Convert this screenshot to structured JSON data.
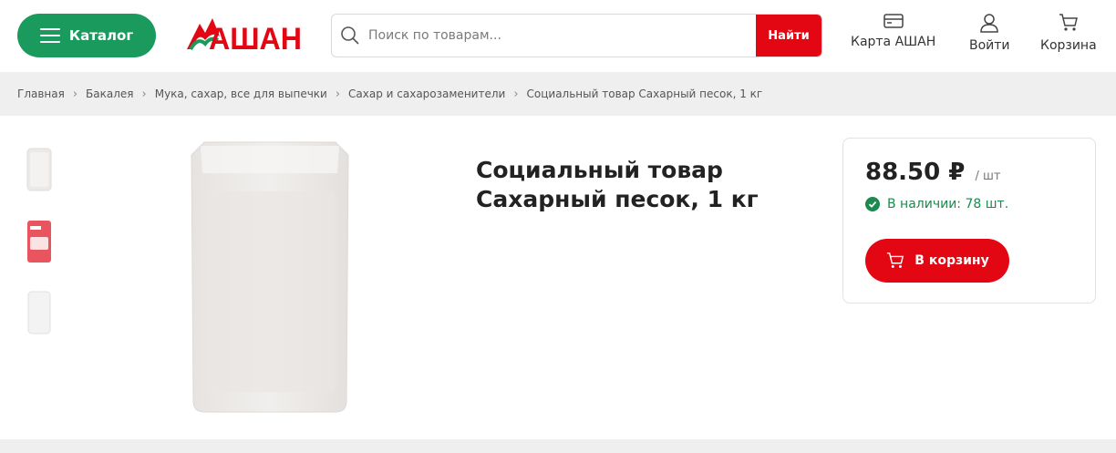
{
  "header": {
    "catalog_label": "Каталог",
    "logo_text": "АШАН",
    "search": {
      "placeholder": "Поиск по товарам...",
      "button_label": "Найти"
    },
    "links": {
      "card_label": "Карта АШАН",
      "login_label": "Войти",
      "cart_label": "Корзина"
    }
  },
  "breadcrumb": [
    "Главная",
    "Бакалея",
    "Мука, сахар, все для выпечки",
    "Сахар и сахарозаменители",
    "Социальный товар Сахарный песок, 1 кг"
  ],
  "product": {
    "title_line1": "Социальный товар",
    "title_line2": "Сахарный песок, 1 кг",
    "price": "88.50 ₽",
    "price_unit": "/ шт",
    "stock": "В наличии: 78 шт.",
    "cart_button": "В корзину"
  },
  "colors": {
    "brand_green": "#1a9a5c",
    "brand_red": "#e30613",
    "stock_green": "#1a8a4e"
  },
  "icons": [
    "menu-icon",
    "auchan-bird-logo",
    "search-icon",
    "card-icon",
    "user-icon",
    "cart-icon",
    "check-circle-icon"
  ]
}
